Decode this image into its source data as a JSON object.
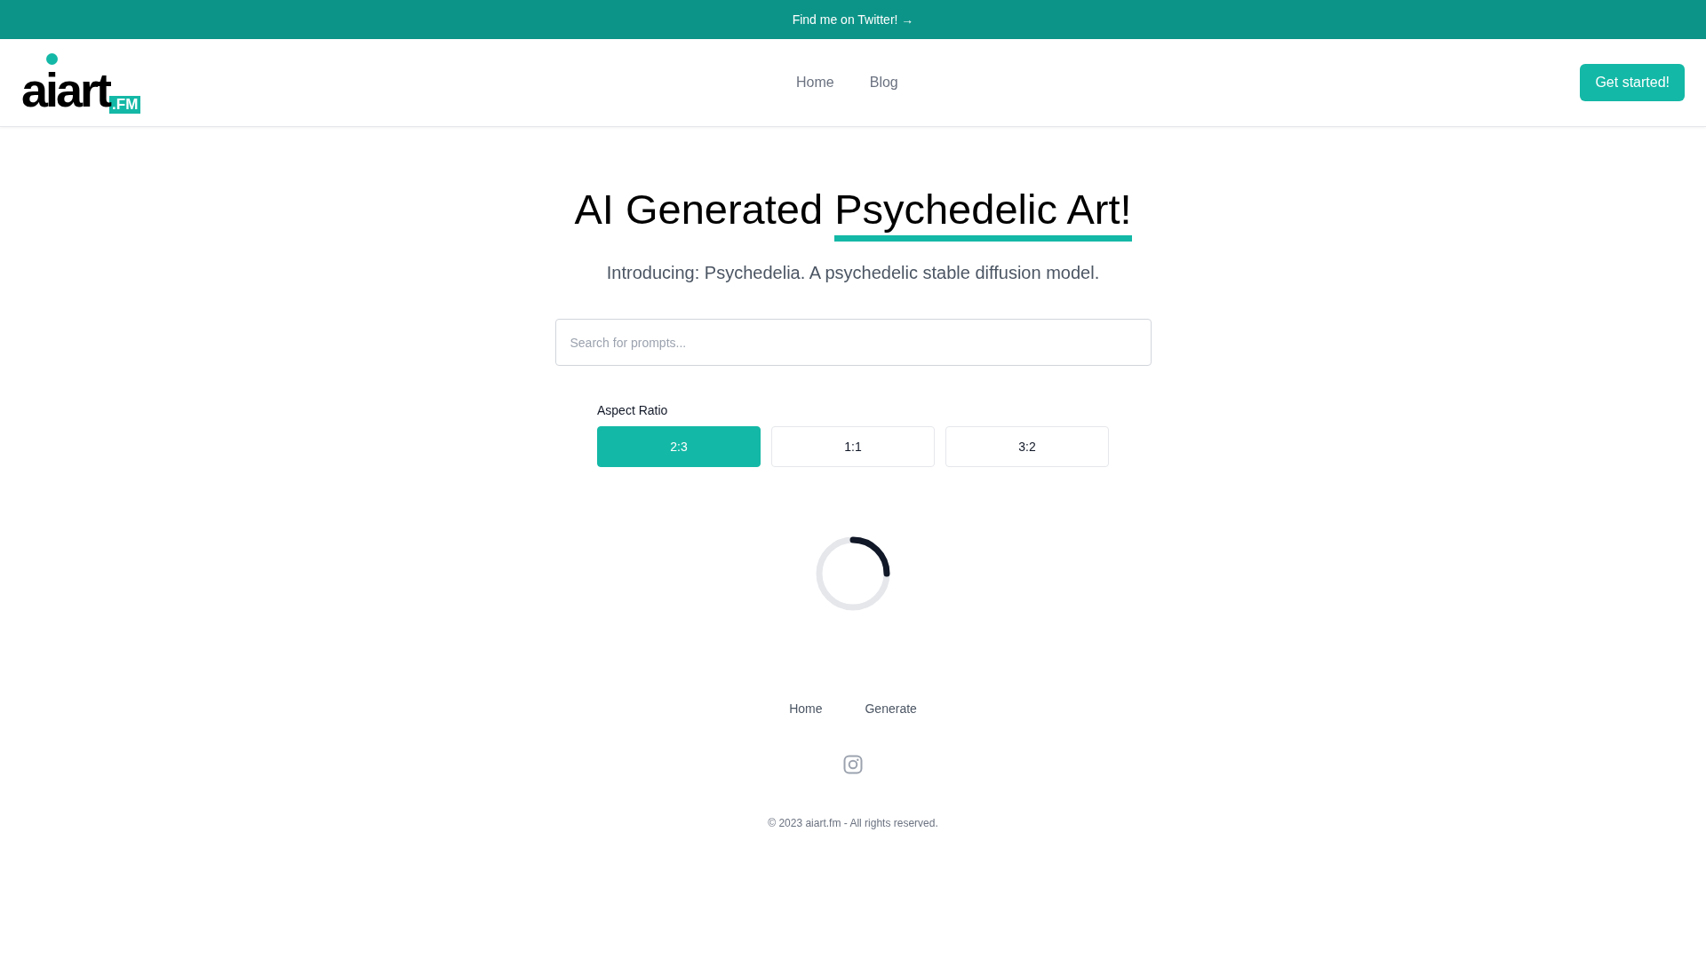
{
  "banner": {
    "text": "Find me on Twitter! →"
  },
  "header": {
    "logo": {
      "text": "aiart",
      "badge": ".FM"
    },
    "nav": [
      "Home",
      "Blog"
    ],
    "cta": "Get started!"
  },
  "hero": {
    "heading": "AI Generated",
    "highlight": "Psychedelic Art!",
    "subtitle": "Introducing: Psychedelia. A psychedelic stable diffusion model."
  },
  "search": {
    "placeholder": "Search for prompts..."
  },
  "aspect_ratio": {
    "label": "Aspect Ratio",
    "options": [
      {
        "label": "2:3",
        "selected": true
      },
      {
        "label": "1:1",
        "selected": false
      },
      {
        "label": "3:2",
        "selected": false
      }
    ]
  },
  "footer": {
    "links": [
      "Home",
      "Generate"
    ],
    "copyright": "© 2023 aiart.fm - All rights reserved."
  }
}
